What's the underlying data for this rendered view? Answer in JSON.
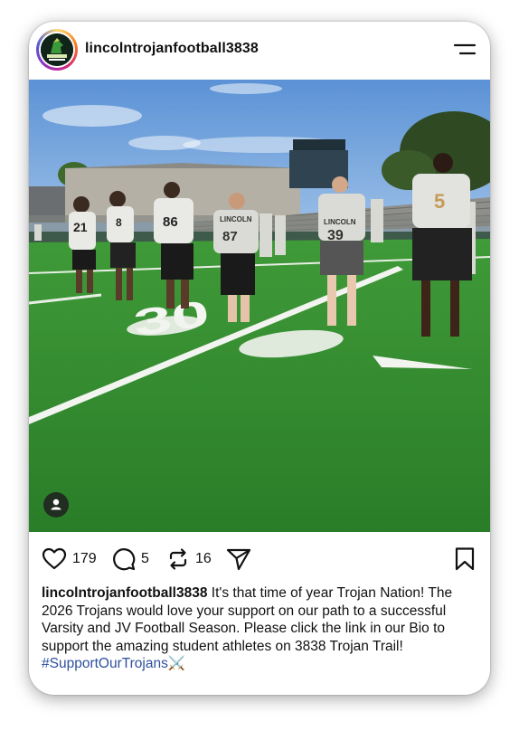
{
  "post": {
    "username": "lincolntrojanfootball3838",
    "avatar_text": "TROJANS FOOTBALL",
    "photo_yard_number": "30",
    "caption_username": "lincolntrojanfootball3838",
    "caption_text": " It's that time of year Trojan Nation! The 2026 Trojans would love your support on our path to a successful Varsity and JV Football Season. Please click the link in our Bio to support the amazing student athletes on 3838 Trojan Trail!",
    "hashtag": "#SupportOurTrojans",
    "hashtag_emoji": "⚔️"
  },
  "actions": {
    "likes": "179",
    "comments": "5",
    "reposts": "16"
  },
  "players": [
    {
      "number": "21"
    },
    {
      "number": "8"
    },
    {
      "number": "86"
    },
    {
      "number": "87"
    },
    {
      "number": "39"
    },
    {
      "number": "5"
    }
  ],
  "jersey_text": "LINCOLN",
  "colors": {
    "text": "#111111",
    "hashtag": "#2e4e9e",
    "turf": "#2f8a2c",
    "sky": "#6fa3dc"
  },
  "icons": {
    "menu": "hamburger-icon",
    "like": "heart-icon",
    "comment": "comment-icon",
    "repost": "repost-icon",
    "share": "send-icon",
    "save": "bookmark-icon",
    "tag": "user-tag-icon"
  }
}
